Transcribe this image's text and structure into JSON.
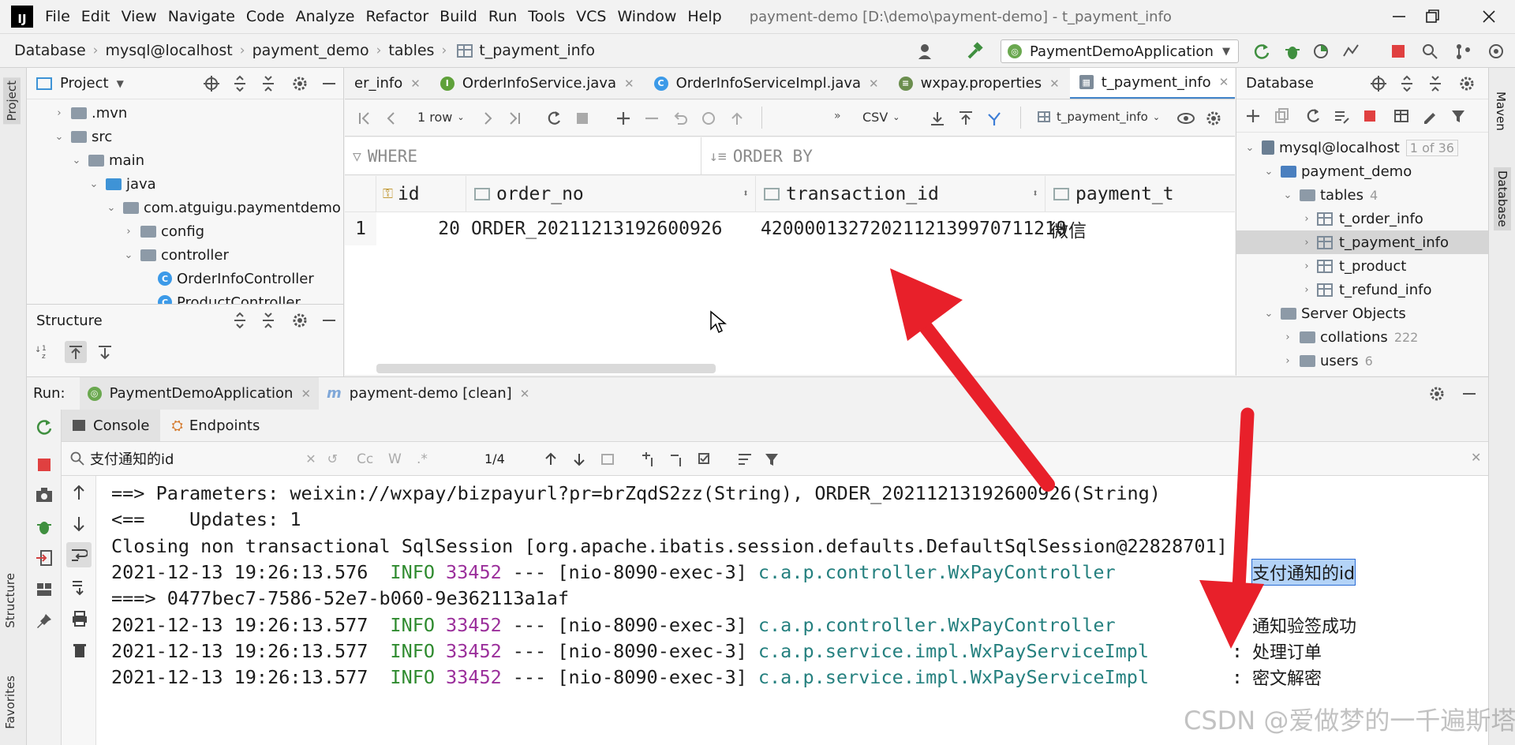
{
  "menubar": {
    "logo": "IJ",
    "items": [
      "File",
      "Edit",
      "View",
      "Navigate",
      "Code",
      "Analyze",
      "Refactor",
      "Build",
      "Run",
      "Tools",
      "VCS",
      "Window",
      "Help"
    ],
    "window_title": "payment-demo [D:\\demo\\payment-demo] - t_payment_info"
  },
  "navbar": {
    "crumbs": [
      "Database",
      "mysql@localhost",
      "payment_demo",
      "tables",
      "t_payment_info"
    ],
    "run_config": "PaymentDemoApplication"
  },
  "project_panel": {
    "title": "Project",
    "tree": [
      {
        "label": ".mvn",
        "level": 1,
        "arrow": "›",
        "kind": "folder"
      },
      {
        "label": "src",
        "level": 1,
        "arrow": "⌄",
        "kind": "folder"
      },
      {
        "label": "main",
        "level": 2,
        "arrow": "⌄",
        "kind": "folder"
      },
      {
        "label": "java",
        "level": 3,
        "arrow": "⌄",
        "kind": "folder-blue"
      },
      {
        "label": "com.atguigu.paymentdemo",
        "level": 4,
        "arrow": "⌄",
        "kind": "folder"
      },
      {
        "label": "config",
        "level": 5,
        "arrow": "›",
        "kind": "folder"
      },
      {
        "label": "controller",
        "level": 5,
        "arrow": "⌄",
        "kind": "folder"
      },
      {
        "label": "OrderInfoController",
        "level": 6,
        "arrow": "",
        "kind": "class"
      },
      {
        "label": "ProductController",
        "level": 6,
        "arrow": "",
        "kind": "class"
      }
    ]
  },
  "structure_panel": {
    "title": "Structure"
  },
  "left_strip": {
    "project": "Project",
    "structure": "Structure",
    "favorites": "Favorites"
  },
  "right_strip": {
    "maven": "Maven",
    "database": "Database"
  },
  "editor_tabs": [
    {
      "label": "er_info",
      "icon": "",
      "color": ""
    },
    {
      "label": "OrderInfoService.java",
      "icon": "I",
      "color": "#5fa13a"
    },
    {
      "label": "OrderInfoServiceImpl.java",
      "icon": "C",
      "color": "#3c9ae8"
    },
    {
      "label": "wxpay.properties",
      "icon": "≡",
      "color": "#6b8e4e"
    },
    {
      "label": "t_payment_info",
      "icon": "▦",
      "color": "#7d8b99",
      "active": true
    }
  ],
  "grid_toolbar": {
    "rows": "1 row",
    "export": "CSV",
    "table": "t_payment_info"
  },
  "filter": {
    "where": "WHERE",
    "order_by": "ORDER BY"
  },
  "grid": {
    "columns": [
      "id",
      "order_no",
      "transaction_id",
      "payment_t"
    ],
    "rows": [
      {
        "num": "1",
        "id": "20",
        "order_no": "ORDER_20211213192600926",
        "transaction_id": "4200001327202112139970711210",
        "payment_t": "微信"
      }
    ]
  },
  "db_panel": {
    "title": "Database",
    "tree": [
      {
        "label": "mysql@localhost",
        "extra": "1 of 36",
        "level": 0,
        "arrow": "⌄",
        "kind": "db"
      },
      {
        "label": "payment_demo",
        "extra": "",
        "level": 1,
        "arrow": "⌄",
        "kind": "schema"
      },
      {
        "label": "tables",
        "extra": "4",
        "level": 2,
        "arrow": "⌄",
        "kind": "folder"
      },
      {
        "label": "t_order_info",
        "extra": "",
        "level": 3,
        "arrow": "›",
        "kind": "table"
      },
      {
        "label": "t_payment_info",
        "extra": "",
        "level": 3,
        "arrow": "›",
        "kind": "table",
        "selected": true
      },
      {
        "label": "t_product",
        "extra": "",
        "level": 3,
        "arrow": "›",
        "kind": "table"
      },
      {
        "label": "t_refund_info",
        "extra": "",
        "level": 3,
        "arrow": "›",
        "kind": "table"
      },
      {
        "label": "Server Objects",
        "extra": "",
        "level": 1,
        "arrow": "⌄",
        "kind": "folder"
      },
      {
        "label": "collations",
        "extra": "222",
        "level": 2,
        "arrow": "›",
        "kind": "folder"
      },
      {
        "label": "users",
        "extra": "6",
        "level": 2,
        "arrow": "›",
        "kind": "folder"
      }
    ]
  },
  "run_panel": {
    "label": "Run:",
    "tabs": [
      "PaymentDemoApplication",
      "payment-demo [clean]"
    ],
    "subtabs": [
      "Console",
      "Endpoints"
    ],
    "search_value": "支付通知的id",
    "match_count": "1/4"
  },
  "console": [
    {
      "kind": "plain",
      "text": "==> Parameters: weixin://wxpay/bizpayurl?pr=brZqdS2zz(String), ORDER_20211213192600926(String)"
    },
    {
      "kind": "plain",
      "text": "<==    Updates: 1"
    },
    {
      "kind": "plain",
      "text": "Closing non transactional SqlSession [org.apache.ibatis.session.defaults.DefaultSqlSession@22828701]"
    },
    {
      "kind": "log",
      "ts": "2021-12-13 19:26:13.576",
      "level": "INFO",
      "pid": "33452",
      "thread": "--- [nio-8090-exec-3]",
      "logger": "c.a.p.controller.WxPayController",
      "msg": "支付通知的id",
      "hl": true
    },
    {
      "kind": "plain",
      "text": "===> 0477bec7-7586-52e7-b060-9e362113a1af"
    },
    {
      "kind": "log",
      "ts": "2021-12-13 19:26:13.577",
      "level": "INFO",
      "pid": "33452",
      "thread": "--- [nio-8090-exec-3]",
      "logger": "c.a.p.controller.WxPayController",
      "msg": "通知验签成功"
    },
    {
      "kind": "log",
      "ts": "2021-12-13 19:26:13.577",
      "level": "INFO",
      "pid": "33452",
      "thread": "--- [nio-8090-exec-3]",
      "logger": "c.a.p.service.impl.WxPayServiceImpl",
      "msg": "处理订单"
    },
    {
      "kind": "log",
      "ts": "2021-12-13 19:26:13.577",
      "level": "INFO",
      "pid": "33452",
      "thread": "--- [nio-8090-exec-3]",
      "logger": "c.a.p.service.impl.WxPayServiceImpl",
      "msg": "密文解密"
    }
  ],
  "watermark": "CSDN @爱做梦的一千遍斯塔克",
  "colors": {
    "accent": "#4083c9",
    "annotation": "#e8202a"
  }
}
